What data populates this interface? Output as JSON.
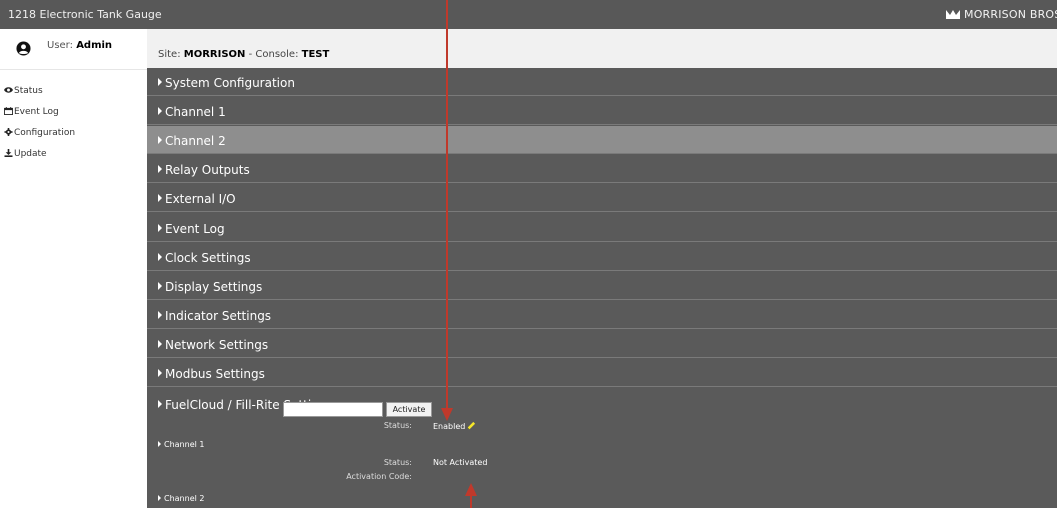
{
  "app": {
    "title": "1218 Electronic Tank Gauge",
    "brand": "MORRISON BROS. CO",
    "brand_icon": "morrison-logo-icon"
  },
  "user": {
    "prefix": "User:",
    "name": "Admin",
    "icon": "user-circle-icon"
  },
  "nav": {
    "items": [
      {
        "label": "Status",
        "icon": "eye-icon"
      },
      {
        "label": "Event Log",
        "icon": "calendar-icon"
      },
      {
        "label": "Configuration",
        "icon": "gear-icon"
      },
      {
        "label": "Update",
        "icon": "download-icon"
      }
    ]
  },
  "site": {
    "site_prefix": "Site:",
    "site_name": "MORRISON",
    "separator": " - ",
    "console_prefix": "Console:",
    "console_name": "TEST"
  },
  "sections": [
    {
      "label": "System Configuration",
      "active": false
    },
    {
      "label": "Channel 1",
      "active": false
    },
    {
      "label": "Channel 2",
      "active": true
    },
    {
      "label": "Relay Outputs",
      "active": false
    },
    {
      "label": "External I/O",
      "active": false
    },
    {
      "label": "Event Log",
      "active": false
    },
    {
      "label": "Clock Settings",
      "active": false
    },
    {
      "label": "Display Settings",
      "active": false
    },
    {
      "label": "Indicator Settings",
      "active": false
    },
    {
      "label": "Network Settings",
      "active": false
    },
    {
      "label": "Modbus Settings",
      "active": false
    }
  ],
  "fuelcloud": {
    "label": "FuelCloud / Fill-Rite Settings",
    "status_label": "Status:",
    "status_value": "Enabled",
    "edit_icon": "pencil-icon",
    "channel1": {
      "label": "Channel 1",
      "status_label": "Status:",
      "status_value": "Not Activated",
      "activation_label": "Activation Code:",
      "activation_value": "",
      "activate_button": "Activate"
    },
    "channel2": {
      "label": "Channel 2"
    }
  },
  "colors": {
    "topbar": "#585858",
    "section_bg": "#5a5a5a",
    "section_active": "#8e8e8e",
    "annotation_arrow": "#c0392b",
    "pencil": "#f5e62a"
  }
}
